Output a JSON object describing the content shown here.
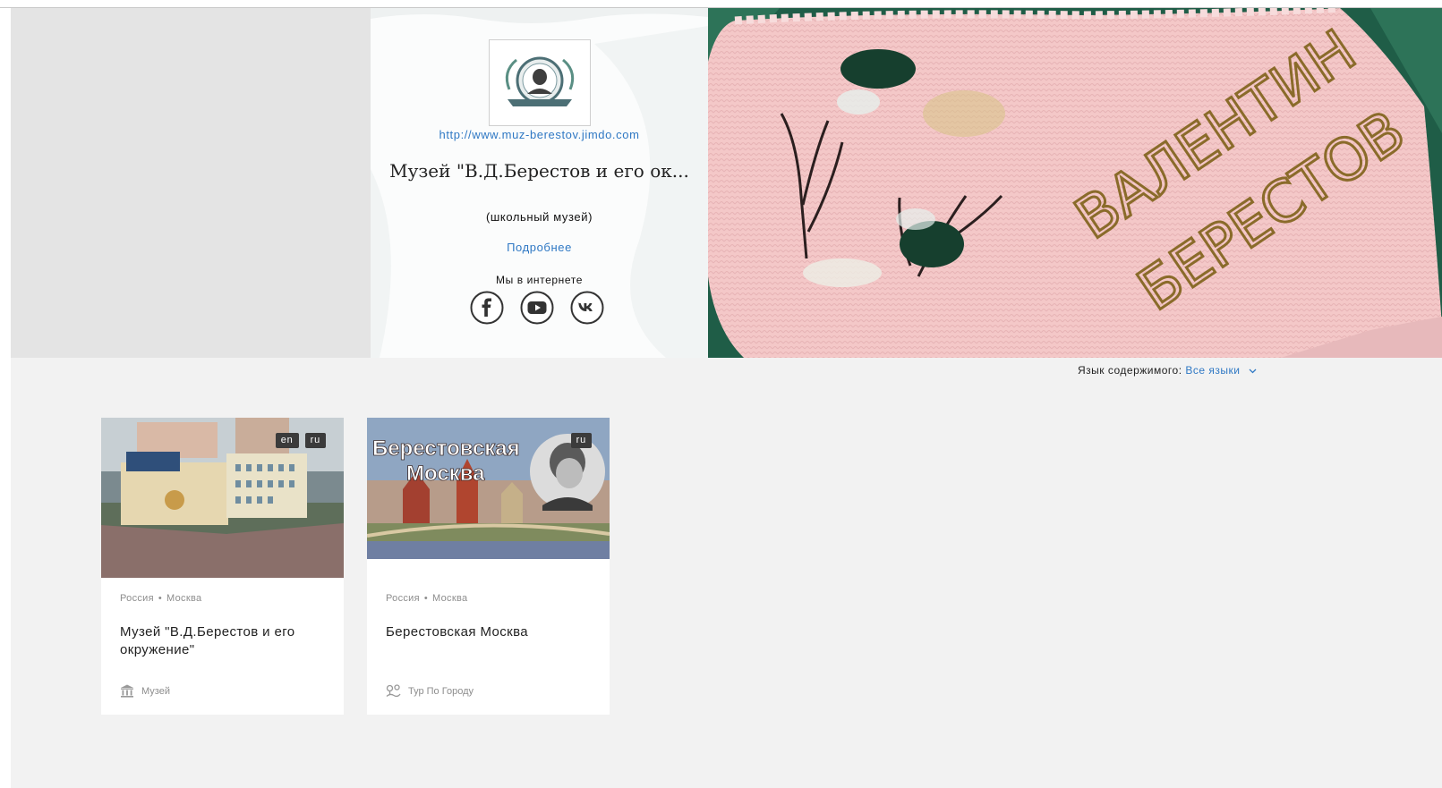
{
  "profile": {
    "website": "http://www.muz-berestov.jimdo.com",
    "title": "Музей \"В.Д.Берестов и его ок...",
    "subtitle": "(школьный музей)",
    "more_link": "Подробнее",
    "online_label": "Мы в интернете",
    "socials": [
      "facebook-icon",
      "youtube-icon",
      "vk-icon"
    ]
  },
  "hero": {
    "embroidered_text_line1": "ВАЛЕНТИН",
    "embroidered_text_line2": "БЕРЕСТОВ"
  },
  "filter": {
    "label": "Язык содержимого:",
    "value": "Все языки"
  },
  "cards": [
    {
      "languages": [
        "en",
        "ru"
      ],
      "location_country": "Россия",
      "location_city": "Москва",
      "title": "Музей \"В.Д.Берестов и его окружение\"",
      "category": "Музей",
      "category_icon": "museum-icon"
    },
    {
      "languages": [
        "ru"
      ],
      "thumb_text_line1": "Берестовская",
      "thumb_text_line2": "Москва",
      "location_country": "Россия",
      "location_city": "Москва",
      "title": "Берестовская Москва",
      "category": "Тур По Городу",
      "category_icon": "city-tour-icon"
    }
  ],
  "colors": {
    "link": "#2f78c4",
    "background": "#f2f2f2",
    "badge": "#3b3b3b",
    "hero_knit": "#f3c6c6",
    "hero_backdrop": "#1f5d47"
  }
}
